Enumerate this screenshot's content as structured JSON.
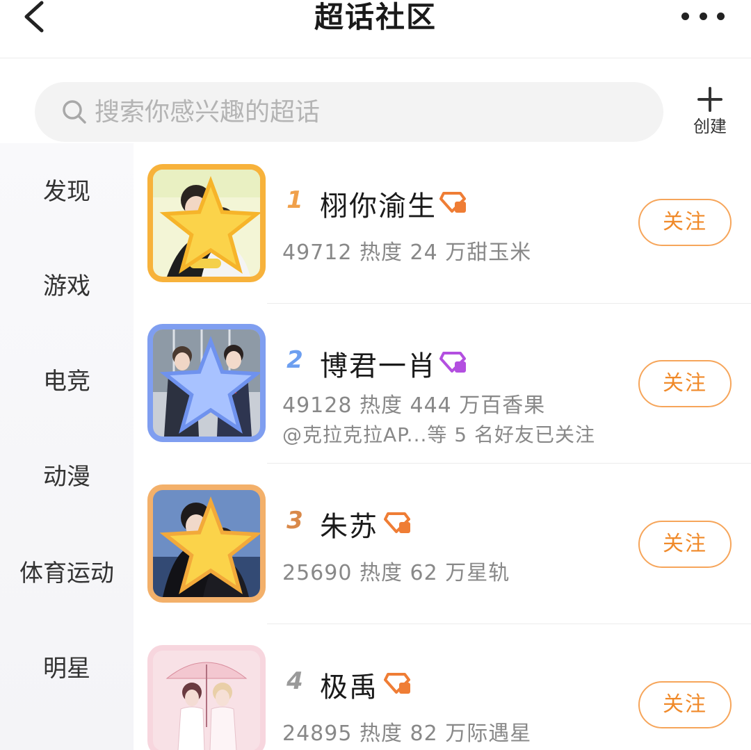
{
  "header": {
    "title": "超话社区",
    "back_icon": "chevron-left-icon",
    "more_icon": "more-horizontal-icon"
  },
  "search": {
    "placeholder": "搜索你感兴趣的超话",
    "icon": "search-icon"
  },
  "create": {
    "label": "创建",
    "icon": "plus-icon"
  },
  "sidebar": {
    "items": [
      {
        "label": "发现"
      },
      {
        "label": "游戏"
      },
      {
        "label": "电竞"
      },
      {
        "label": "动漫"
      },
      {
        "label": "体育运动"
      },
      {
        "label": "明星"
      }
    ]
  },
  "topics": [
    {
      "rank": "1",
      "name": "栩你渝生",
      "stats": "49712 热度 24 万甜玉米",
      "friends": "",
      "follow_label": "关注",
      "badge_color": "#ef7d35",
      "rank_color": "#f0a04a",
      "frame_color": "#f7b23b"
    },
    {
      "rank": "2",
      "name": "博君一肖",
      "stats": "49128 热度 444 万百香果",
      "friends": "@克拉克拉AP...等 5 名好友已关注",
      "follow_label": "关注",
      "badge_color": "#b34fe0",
      "rank_color": "#6d9ff0",
      "frame_color": "#7f9ef0"
    },
    {
      "rank": "3",
      "name": "朱苏",
      "stats": "25690 热度 62 万星轨",
      "friends": "",
      "follow_label": "关注",
      "badge_color": "#ef7d35",
      "rank_color": "#d9894a",
      "frame_color": "#f3b06a"
    },
    {
      "rank": "4",
      "name": "极禹",
      "stats": "24895 热度 82 万际遇星",
      "friends": "",
      "follow_label": "关注",
      "badge_color": "#ef7d35",
      "rank_color": "#9a9a9a",
      "frame_color": "#f7d6de"
    }
  ],
  "colors": {
    "accent": "#f08a2a",
    "text_secondary": "#888888"
  }
}
